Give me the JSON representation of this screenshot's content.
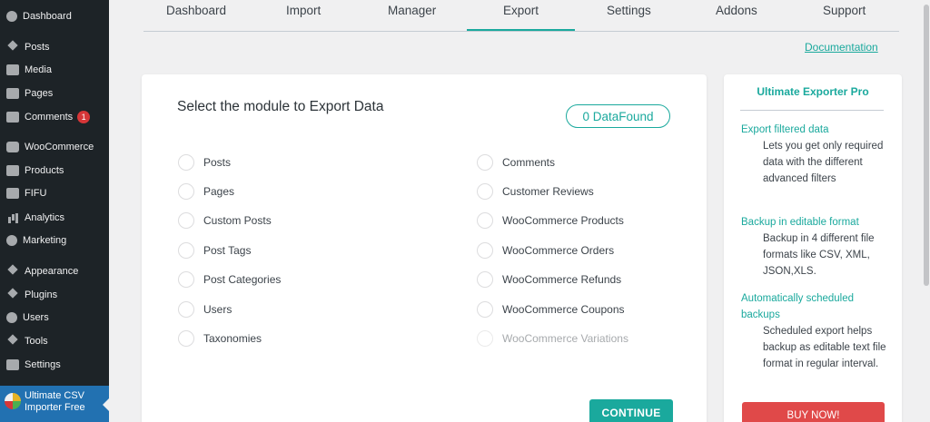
{
  "sidebar": {
    "items": [
      {
        "label": "Dashboard",
        "icon": "dashboard-icon"
      },
      {
        "label": "Posts",
        "icon": "pin-icon"
      },
      {
        "label": "Media",
        "icon": "media-icon"
      },
      {
        "label": "Pages",
        "icon": "pages-icon"
      },
      {
        "label": "Comments",
        "icon": "comment-icon",
        "badge": "1"
      },
      {
        "label": "WooCommerce",
        "icon": "woo-icon"
      },
      {
        "label": "Products",
        "icon": "products-icon"
      },
      {
        "label": "FIFU",
        "icon": "fifu-icon"
      },
      {
        "label": "Analytics",
        "icon": "analytics-icon"
      },
      {
        "label": "Marketing",
        "icon": "megaphone-icon"
      },
      {
        "label": "Appearance",
        "icon": "brush-icon"
      },
      {
        "label": "Plugins",
        "icon": "plug-icon"
      },
      {
        "label": "Users",
        "icon": "users-icon"
      },
      {
        "label": "Tools",
        "icon": "wrench-icon"
      },
      {
        "label": "Settings",
        "icon": "settings-icon"
      }
    ],
    "active": {
      "line1": "Ultimate CSV",
      "line2": "Importer Free"
    }
  },
  "tabs": [
    "Dashboard",
    "Import",
    "Manager",
    "Export",
    "Settings",
    "Addons",
    "Support"
  ],
  "active_tab": "Export",
  "documentation_link": "Documentation",
  "export": {
    "title": "Select the module to Export Data",
    "found_badge": "0 DataFound",
    "left_options": [
      "Posts",
      "Pages",
      "Custom Posts",
      "Post Tags",
      "Post Categories",
      "Users",
      "Taxonomies"
    ],
    "right_options": [
      "Comments",
      "Customer Reviews",
      "WooCommerce Products",
      "WooCommerce Orders",
      "WooCommerce Refunds",
      "WooCommerce Coupons",
      "WooCommerce Variations"
    ],
    "continue_label": "CONTINUE"
  },
  "pro": {
    "title": "Ultimate Exporter Pro",
    "features": [
      {
        "heading": "Export filtered data",
        "desc": "Lets you get only required data with the different advanced filters"
      },
      {
        "heading": "Backup in editable format",
        "desc": "Backup in 4 different file formats like CSV, XML, JSON,XLS."
      },
      {
        "heading": "Automatically scheduled backups",
        "desc": "Scheduled export helps backup as editable text file format in regular interval."
      }
    ],
    "buy_label": "BUY NOW!"
  },
  "colors": {
    "accent": "#1aa99d",
    "sidebar": "#1d2327",
    "active_sidebar": "#2271b1",
    "buy": "#e04949"
  }
}
